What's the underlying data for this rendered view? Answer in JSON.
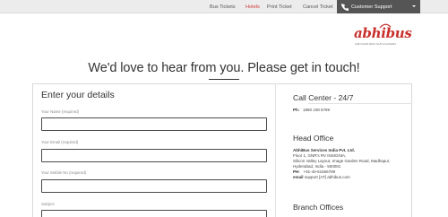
{
  "nav": {
    "items": [
      {
        "label": "Bus Tickets",
        "active": false
      },
      {
        "label": "Hotels",
        "active": true
      },
      {
        "label": "Print Ticket",
        "active": false
      },
      {
        "label": "Cancel Ticket",
        "active": false
      }
    ],
    "support_label": "Customer Support",
    "active_color": "#d33a3a"
  },
  "logo": {
    "word": "abhibus",
    "tagline": "AAB SAFAR MEIN SAATHI HAMARA"
  },
  "headline": "We'd love to hear from you. Please get in touch!",
  "form": {
    "title": "Enter your details",
    "fields": [
      {
        "label": "Your Name (required)",
        "value": ""
      },
      {
        "label": "Your Email (required)",
        "value": ""
      },
      {
        "label": "Your Mobile No (required)",
        "value": ""
      },
      {
        "label": "Subject",
        "value": ""
      }
    ]
  },
  "contact": {
    "call_center_title": "Call Center - 24/7",
    "phone_label": "Ph:",
    "phone": "1860 108 6789",
    "head_office_title": "Head Office",
    "company": "AbhiBus Services India Pvt. Ltd.",
    "address_lines": [
      "Floor 1, GNR's RV INSIGNIA,",
      "Silicon Valley Layout, Image Garden Road, Madhapur,",
      "Hyderabad, India - 500081"
    ],
    "ph_label": "PH:",
    "ph_value": "+91-40-61656789",
    "email_label": "email",
    "email_value": "support [AT] abhibus.com",
    "branch_title": "Branch Offices"
  }
}
